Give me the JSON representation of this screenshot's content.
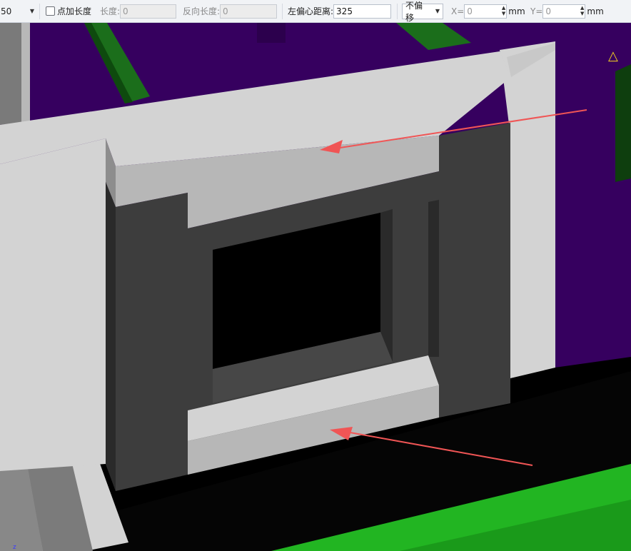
{
  "toolbar": {
    "scale_value": "50",
    "add_length_label": "点加长度",
    "length_label": "长度:",
    "length_value": "0",
    "reverse_length_label": "反向长度:",
    "reverse_length_value": "0",
    "left_offset_label": "左偏心距离:",
    "left_offset_value": "325",
    "offset_mode": "不偏移",
    "x_label": "X=",
    "x_value": "0",
    "x_unit": "mm",
    "y_label": "Y=",
    "y_value": "0",
    "y_unit": "mm"
  },
  "viewport": {
    "axis_label": "z",
    "colors": {
      "background": "#000000",
      "purple_slab": "#36005f",
      "green_beam": "#1b6e1b",
      "green_floor": "#22b522",
      "wall_light": "#d3d3d3",
      "wall_mid": "#b7b7b7",
      "wall_dark": "#3d3d3d",
      "arrow": "#f05555"
    }
  }
}
